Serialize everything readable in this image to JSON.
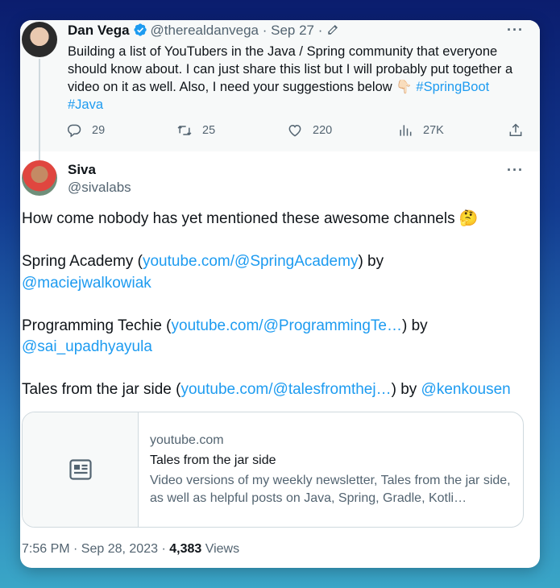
{
  "quoted": {
    "author_name": "Dan Vega",
    "author_handle": "@therealdanvega",
    "date": "· Sep 27 ·",
    "more": "···",
    "text": "Building a list of YouTubers in the Java / Spring community that everyone should know about. I can just share this list but I will probably put together a video on it as well. Also, I need your suggestions below 👇🏻",
    "hashtag1": "#SpringBoot",
    "hashtag2": "#Java",
    "stats": {
      "replies": "29",
      "retweets": "25",
      "likes": "220",
      "views": "27K"
    }
  },
  "reply": {
    "author_name": "Siva",
    "author_handle": "@sivalabs",
    "more": "···",
    "line1": "How come nobody has yet mentioned these awesome channels 🤔",
    "item1_pre": "Spring Academy (",
    "item1_link": "youtube.com/@SpringAcademy",
    "item1_mid": ") by",
    "item1_mention": "@maciejwalkowiak",
    "item2_pre": "Programming Techie (",
    "item2_link": "youtube.com/@ProgrammingTe…",
    "item2_mid": ") by",
    "item2_mention": "@sai_upadhyayula",
    "item3_pre": "Tales from the jar side (",
    "item3_link": "youtube.com/@talesfromthej…",
    "item3_mid": ") by ",
    "item3_mention": "@kenkousen"
  },
  "link_card": {
    "icon": "article-icon",
    "domain": "youtube.com",
    "title": "Tales from the jar side",
    "description": "Video versions of my weekly newsletter, Tales from the jar side, as well as helpful posts on Java, Spring, Gradle, Kotli…"
  },
  "footer": {
    "time": "7:56 PM · Sep 28, 2023 · ",
    "views_count": "4,383",
    "views_label": " Views"
  },
  "colors": {
    "link": "#1d9bf0",
    "verified": "#1d9bf0",
    "text": "#0f1419",
    "muted": "#536471"
  }
}
